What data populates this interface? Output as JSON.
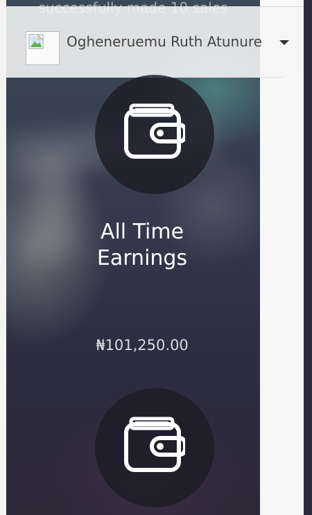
{
  "previous_card": {
    "caption": "successfully made 10 sales"
  },
  "user_menu": {
    "name": "Ogheneruemu Ruth Atunure",
    "avatar_icon": "broken-image-icon",
    "dropdown_icon": "caret-down-icon"
  },
  "earnings_card": {
    "icon": "wallet-icon",
    "title": "All Time Earnings",
    "amount": "₦101,250.00"
  },
  "next_card": {
    "icon": "wallet-icon"
  },
  "colors": {
    "card_overlay": "#2d2c41",
    "circle": "#1c1c26",
    "text_light": "#ffffff",
    "user_text": "#444444"
  }
}
